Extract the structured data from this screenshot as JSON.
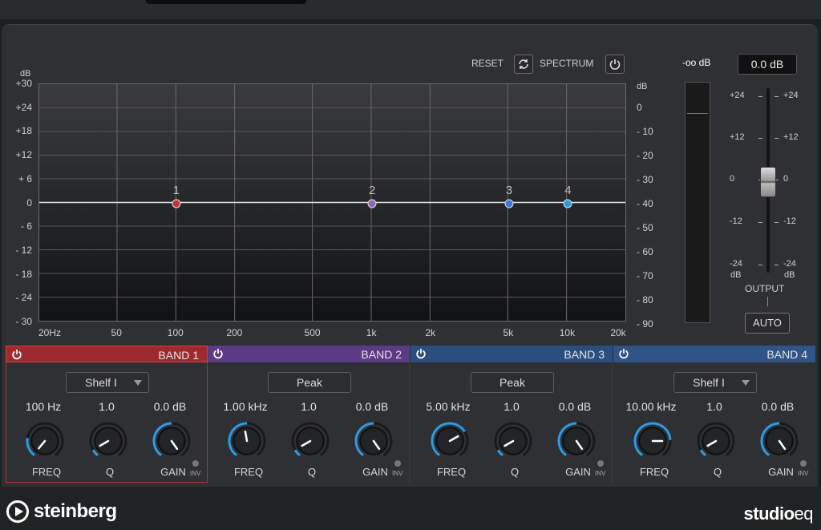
{
  "controls": {
    "reset": "RESET",
    "spectrum": "SPECTRUM"
  },
  "graph": {
    "left_unit": "dB",
    "right_unit": "dB",
    "left_labels": [
      "+30",
      "+24",
      "+18",
      "+12",
      "+ 6",
      "0",
      "- 6",
      "- 12",
      "- 18",
      "- 24",
      "- 30"
    ],
    "right_labels": [
      "0",
      "- 10",
      "- 20",
      "- 30",
      "- 40",
      "- 50",
      "- 60",
      "- 70",
      "- 80",
      "- 90"
    ],
    "x_labels": [
      "20Hz",
      "50",
      "100",
      "200",
      "500",
      "1k",
      "2k",
      "5k",
      "10k",
      "20k"
    ],
    "nodes": [
      {
        "label": "1",
        "color": "#c0343a"
      },
      {
        "label": "2",
        "color": "#8a6bb0"
      },
      {
        "label": "3",
        "color": "#3a7bd5"
      },
      {
        "label": "4",
        "color": "#2a9bd8"
      }
    ]
  },
  "meter": {
    "peak": "-oo dB"
  },
  "output": {
    "value": "0.0 dB",
    "scale_left": [
      "+24",
      "+12",
      "0",
      "-12",
      "-24"
    ],
    "scale_right": [
      "+24",
      "+12",
      "0",
      "-12",
      "-24"
    ],
    "unit_left": "dB",
    "unit_right": "dB",
    "label": "OUTPUT",
    "auto": "AUTO",
    "level_db": 0
  },
  "bands": [
    {
      "title": "BAND 1",
      "type": "Shelf I",
      "has_arrow": true,
      "freq": "100 Hz",
      "q": "1.0",
      "gain": "0.0 dB",
      "header_color": "#9e2a2f",
      "active": true
    },
    {
      "title": "BAND 2",
      "type": "Peak",
      "has_arrow": false,
      "freq": "1.00 kHz",
      "q": "1.0",
      "gain": "0.0 dB",
      "header_color": "#5b3a86",
      "active": false
    },
    {
      "title": "BAND 3",
      "type": "Peak",
      "has_arrow": false,
      "freq": "5.00 kHz",
      "q": "1.0",
      "gain": "0.0 dB",
      "header_color": "#2b4e7e",
      "active": false
    },
    {
      "title": "BAND 4",
      "type": "Shelf I",
      "has_arrow": true,
      "freq": "10.00 kHz",
      "q": "1.0",
      "gain": "0.0 dB",
      "header_color": "#2e5488",
      "active": false
    }
  ],
  "labels": {
    "freq": "FREQ",
    "q": "Q",
    "gain": "GAIN",
    "inv": "INV"
  },
  "footer": {
    "brand": "steinberg",
    "product_bold": "studio",
    "product_light": "eq"
  },
  "colors": {
    "accent_blue": "#2d9be6"
  }
}
